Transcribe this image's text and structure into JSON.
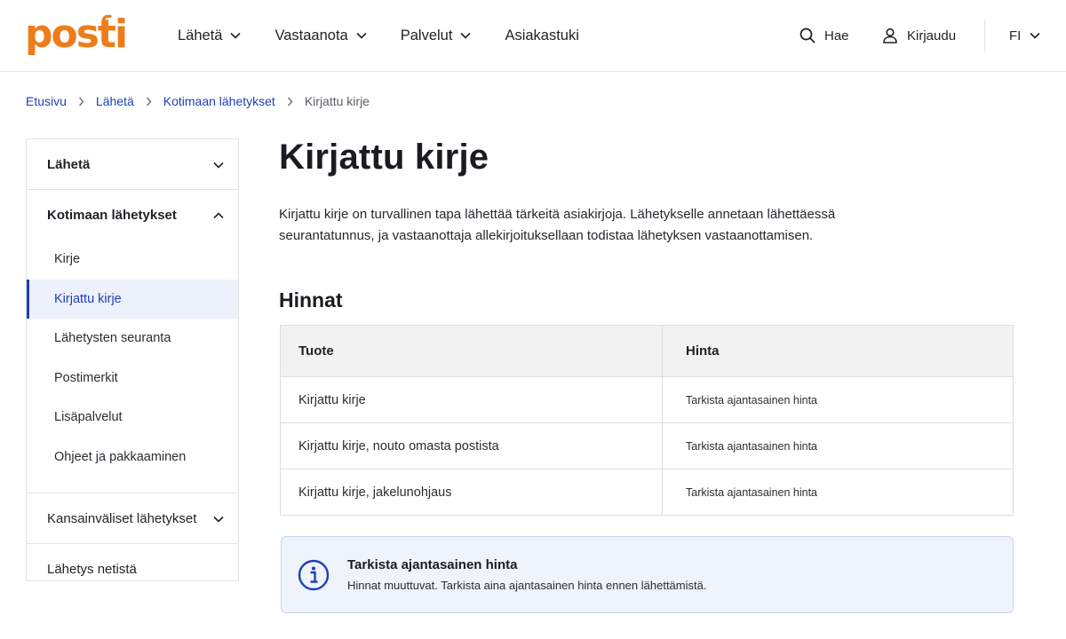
{
  "header": {
    "logo_text": "posti",
    "nav": [
      {
        "label": "Lähetä",
        "dropdown": true
      },
      {
        "label": "Vastaanota",
        "dropdown": true
      },
      {
        "label": "Palvelut",
        "dropdown": true
      },
      {
        "label": "Asiakastuki",
        "dropdown": false
      }
    ],
    "search_label": "Hae",
    "login_label": "Kirjaudu",
    "language": "FI"
  },
  "breadcrumb": {
    "items": [
      "Etusivu",
      "Lähetä",
      "Kotimaan lähetykset"
    ],
    "current": "Kirjattu kirje"
  },
  "sidebar": {
    "sections": [
      {
        "label": "Lähetä",
        "expanded": false
      },
      {
        "label": "Kotimaan lähetykset",
        "expanded": true,
        "items": [
          "Kirje",
          "Kirjattu kirje",
          "Lähetysten seuranta",
          "Postimerkit",
          "Lisäpalvelut",
          "Ohjeet ja pakkaaminen"
        ],
        "active_item": "Kirjattu kirje"
      },
      {
        "label": "Kansainväliset lähetykset",
        "expanded": false
      },
      {
        "label": "Lähetys netistä"
      }
    ]
  },
  "main": {
    "title": "Kirjattu kirje",
    "intro_line1": "Kirjattu kirje on turvallinen tapa lähettää tärkeitä asiakirjoja. Lähetykselle annetaan lähettäessä",
    "intro_line2": "seurantatunnus, ja vastaanottaja allekirjoituksellaan todistaa lähetyksen vastaanottamisen.",
    "prices_title": "Hinnat",
    "table": {
      "headers": [
        "Tuote",
        "Hinta"
      ],
      "rows": [
        [
          "Kirjattu kirje",
          "Tarkista ajantasainen hinta"
        ],
        [
          "Kirjattu kirje, nouto omasta postista",
          "Tarkista ajantasainen hinta"
        ],
        [
          "Kirjattu kirje, jakelunohjaus",
          "Tarkista ajantasainen hinta"
        ]
      ]
    },
    "info": {
      "title": "Tarkista ajantasainen hinta",
      "text": "Hinnat muuttuvat. Tarkista aina ajantasainen hinta ennen lähettämistä."
    }
  },
  "colors": {
    "brand_orange": "#ee7c1b",
    "link_blue": "#1d3fb8",
    "active_bg": "#edf1fb",
    "info_bg": "#eef3fc"
  }
}
